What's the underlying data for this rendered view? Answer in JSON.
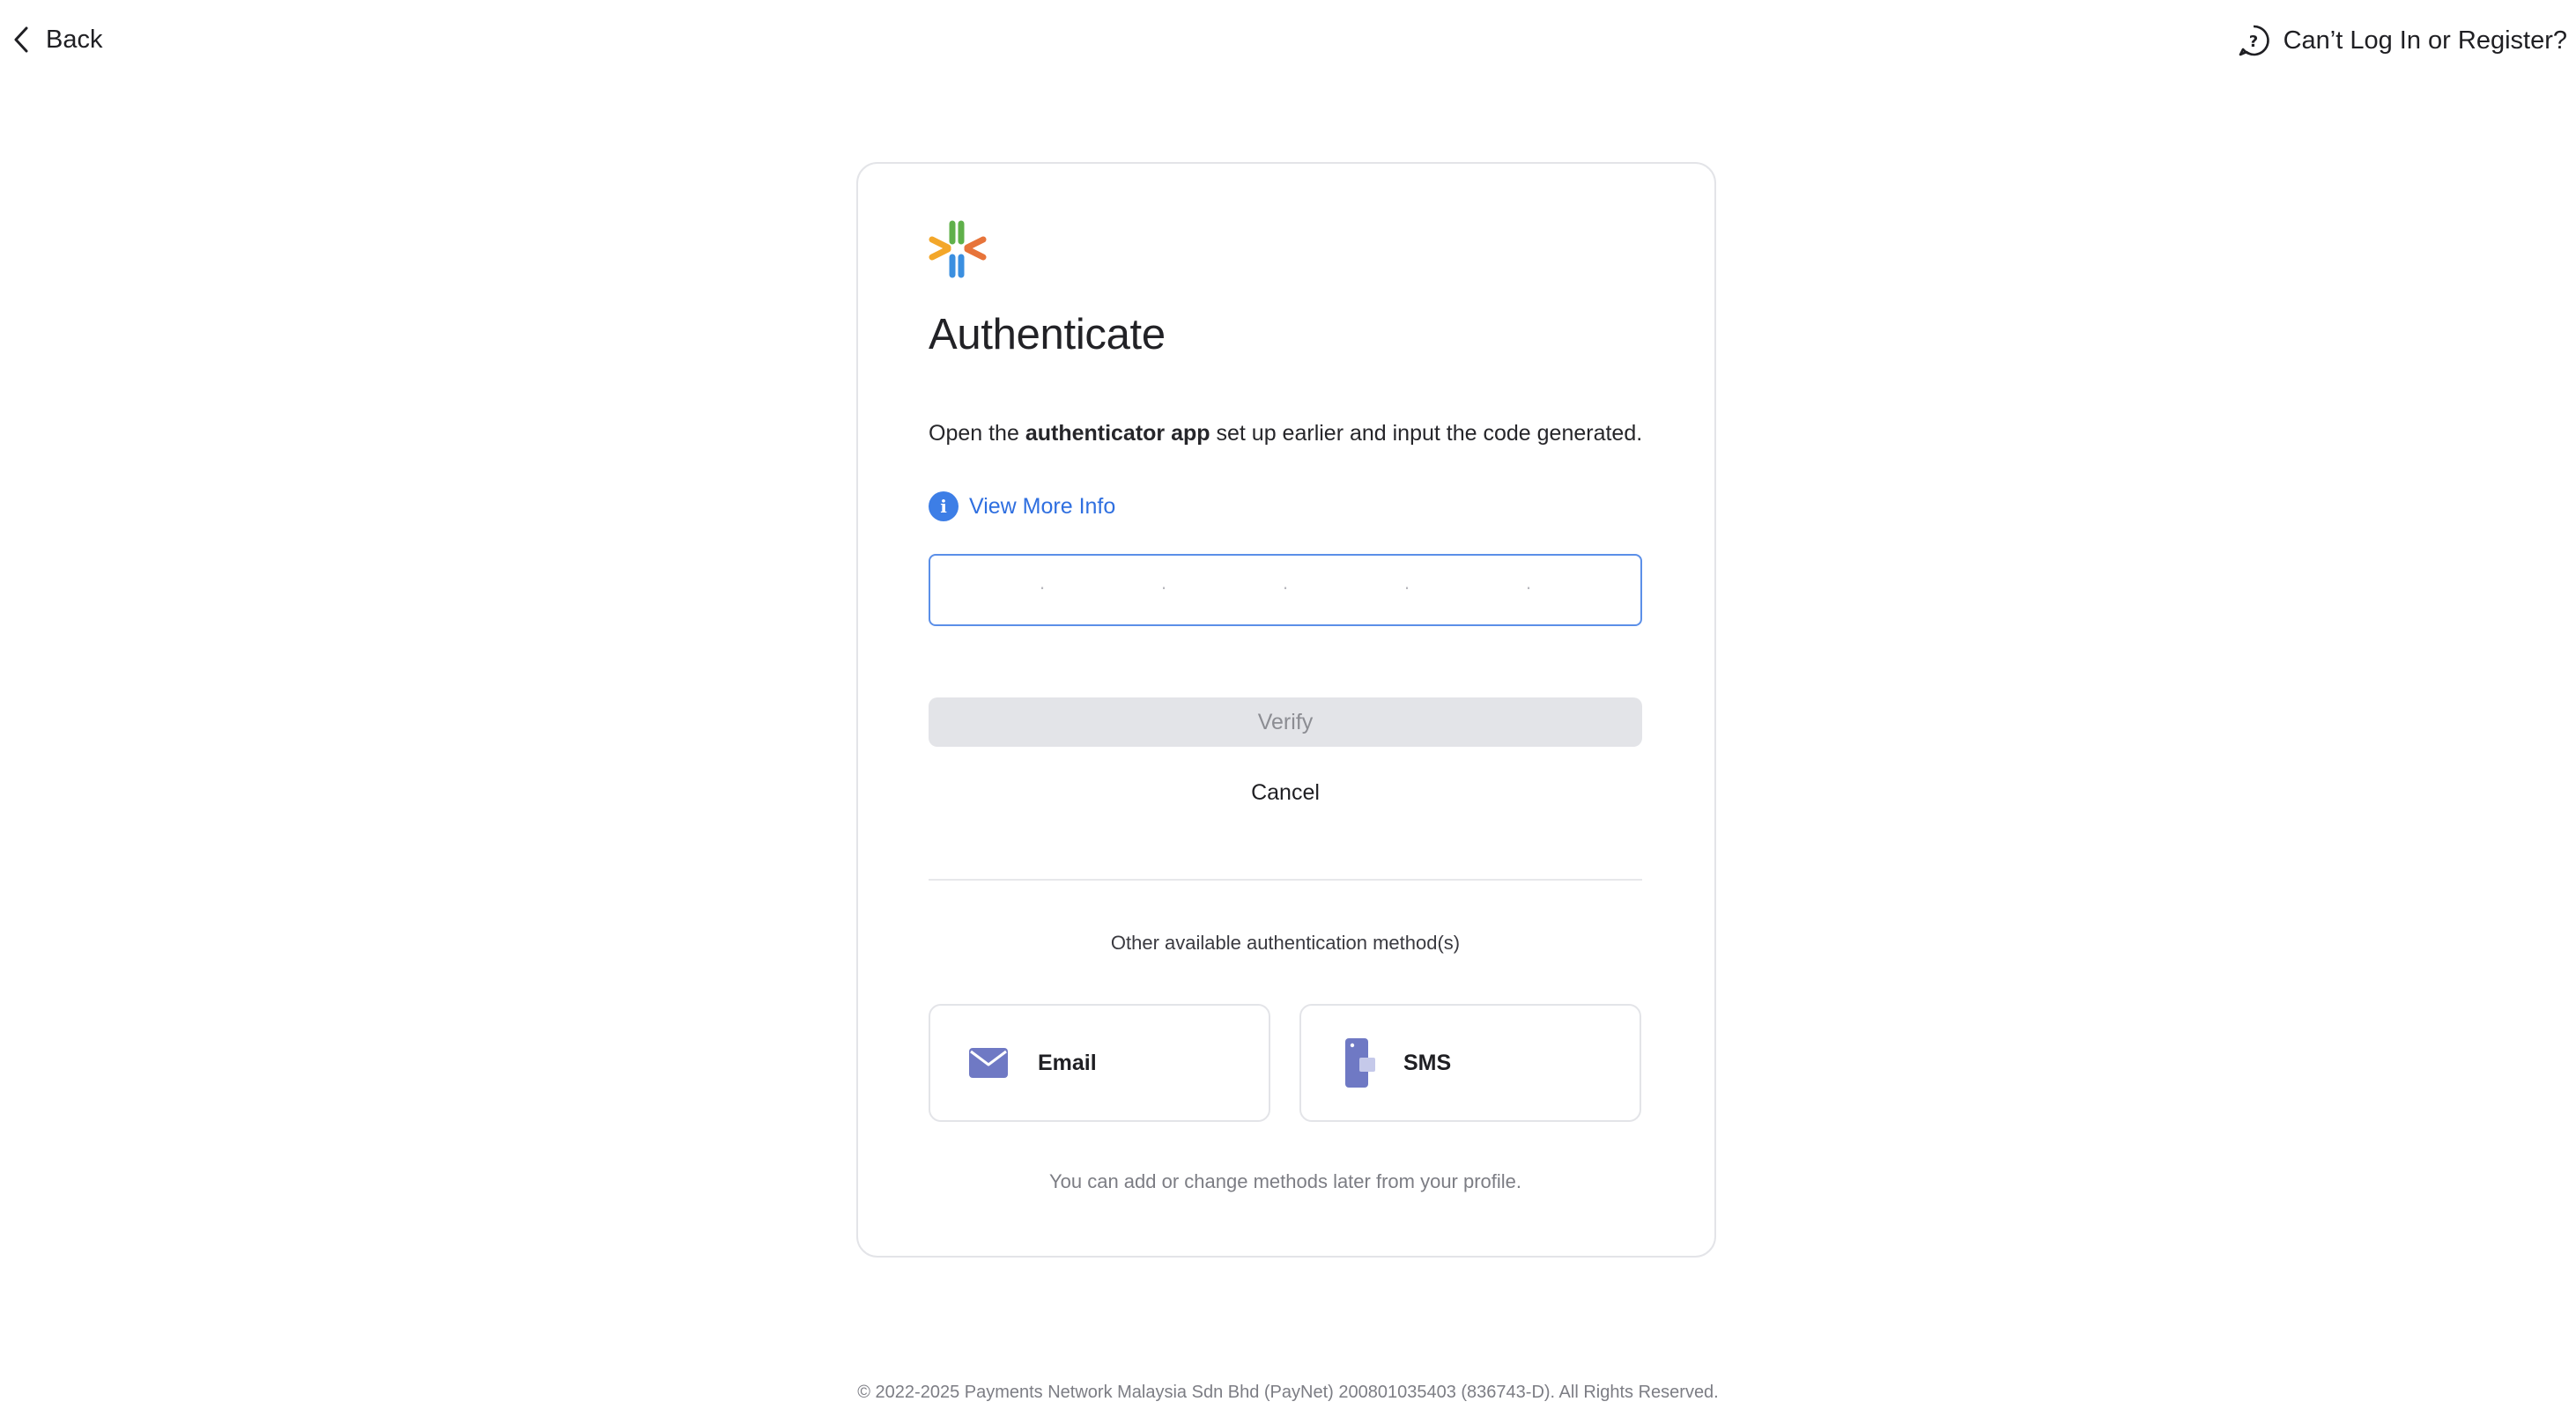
{
  "topbar": {
    "back_label": "Back",
    "help_label": "Can’t Log In or Register?"
  },
  "card": {
    "title": "Authenticate",
    "description_prefix": "Open the ",
    "description_bold": "authenticator app",
    "description_suffix": " set up earlier and input the code generated.",
    "info_link": "View More Info",
    "code_slots": [
      "·",
      "·",
      "·",
      "·",
      "·"
    ],
    "verify_label": "Verify",
    "cancel_label": "Cancel",
    "other_methods_title": "Other available authentication method(s)",
    "methods": [
      {
        "label": "Email",
        "icon": "envelope-icon"
      },
      {
        "label": "SMS",
        "icon": "phone-icon"
      }
    ],
    "footnote": "You can add or change methods later from your profile."
  },
  "footer": {
    "copyright": "© 2022-2025 Payments Network Malaysia Sdn Bhd (PayNet) 200801035403 (836743-D). All Rights Reserved."
  },
  "colors": {
    "accent": "#3d7ee6",
    "link": "#2f6fe0",
    "input_border": "#5b8fe8",
    "disabled_bg": "#e3e4e8",
    "method_icon": "#6f79c4"
  }
}
